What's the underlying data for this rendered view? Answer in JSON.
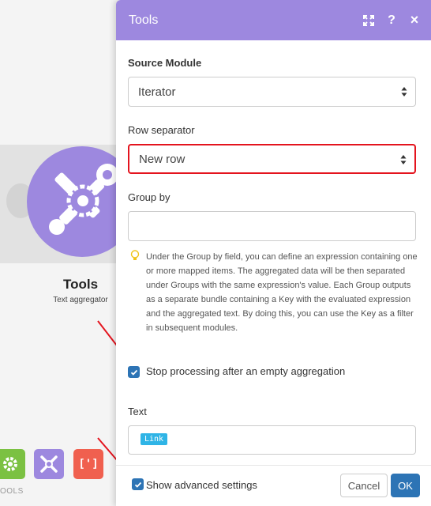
{
  "background": {
    "module": {
      "title": "Tools",
      "subtitle": "Text aggregator",
      "icon": "wrench-gear-icon"
    },
    "toolbar": {
      "buttons": [
        {
          "name": "settings",
          "icon": "gear-icon",
          "color": "#7bc142"
        },
        {
          "name": "tools",
          "icon": "tools-icon",
          "color": "#9d88df"
        },
        {
          "name": "text-parser",
          "icon": "brackets-icon",
          "label": "[']",
          "color": "#f0604f"
        }
      ],
      "label": "OOLS"
    }
  },
  "modal": {
    "title": "Tools",
    "header_icons": [
      "expand-icon",
      "help-icon",
      "close-icon"
    ],
    "header_help_glyph": "?",
    "header_close_glyph": "×",
    "source_module": {
      "label": "Source Module",
      "value": "Iterator"
    },
    "row_separator": {
      "label": "Row separator",
      "value": "New row"
    },
    "group_by": {
      "label": "Group by",
      "value": "",
      "help": "Under the Group by field, you can define an expression containing one or more mapped items. The aggregated data will be then separated under Groups with the same expression's value. Each Group outputs as a separate bundle containing a Key with the evaluated expression and the aggregated text. By doing this, you can use the Key as a filter in subsequent modules."
    },
    "stop_processing": {
      "label": "Stop processing after an empty aggregation",
      "checked": true
    },
    "text": {
      "label": "Text",
      "tag": "Link"
    },
    "footer": {
      "advanced": {
        "label": "Show advanced settings",
        "checked": true
      },
      "cancel": "Cancel",
      "ok": "OK"
    }
  },
  "colors": {
    "accent": "#9d88df",
    "primary": "#2d74b5",
    "highlight": "#e4141e",
    "tag": "#2fb4e6"
  }
}
